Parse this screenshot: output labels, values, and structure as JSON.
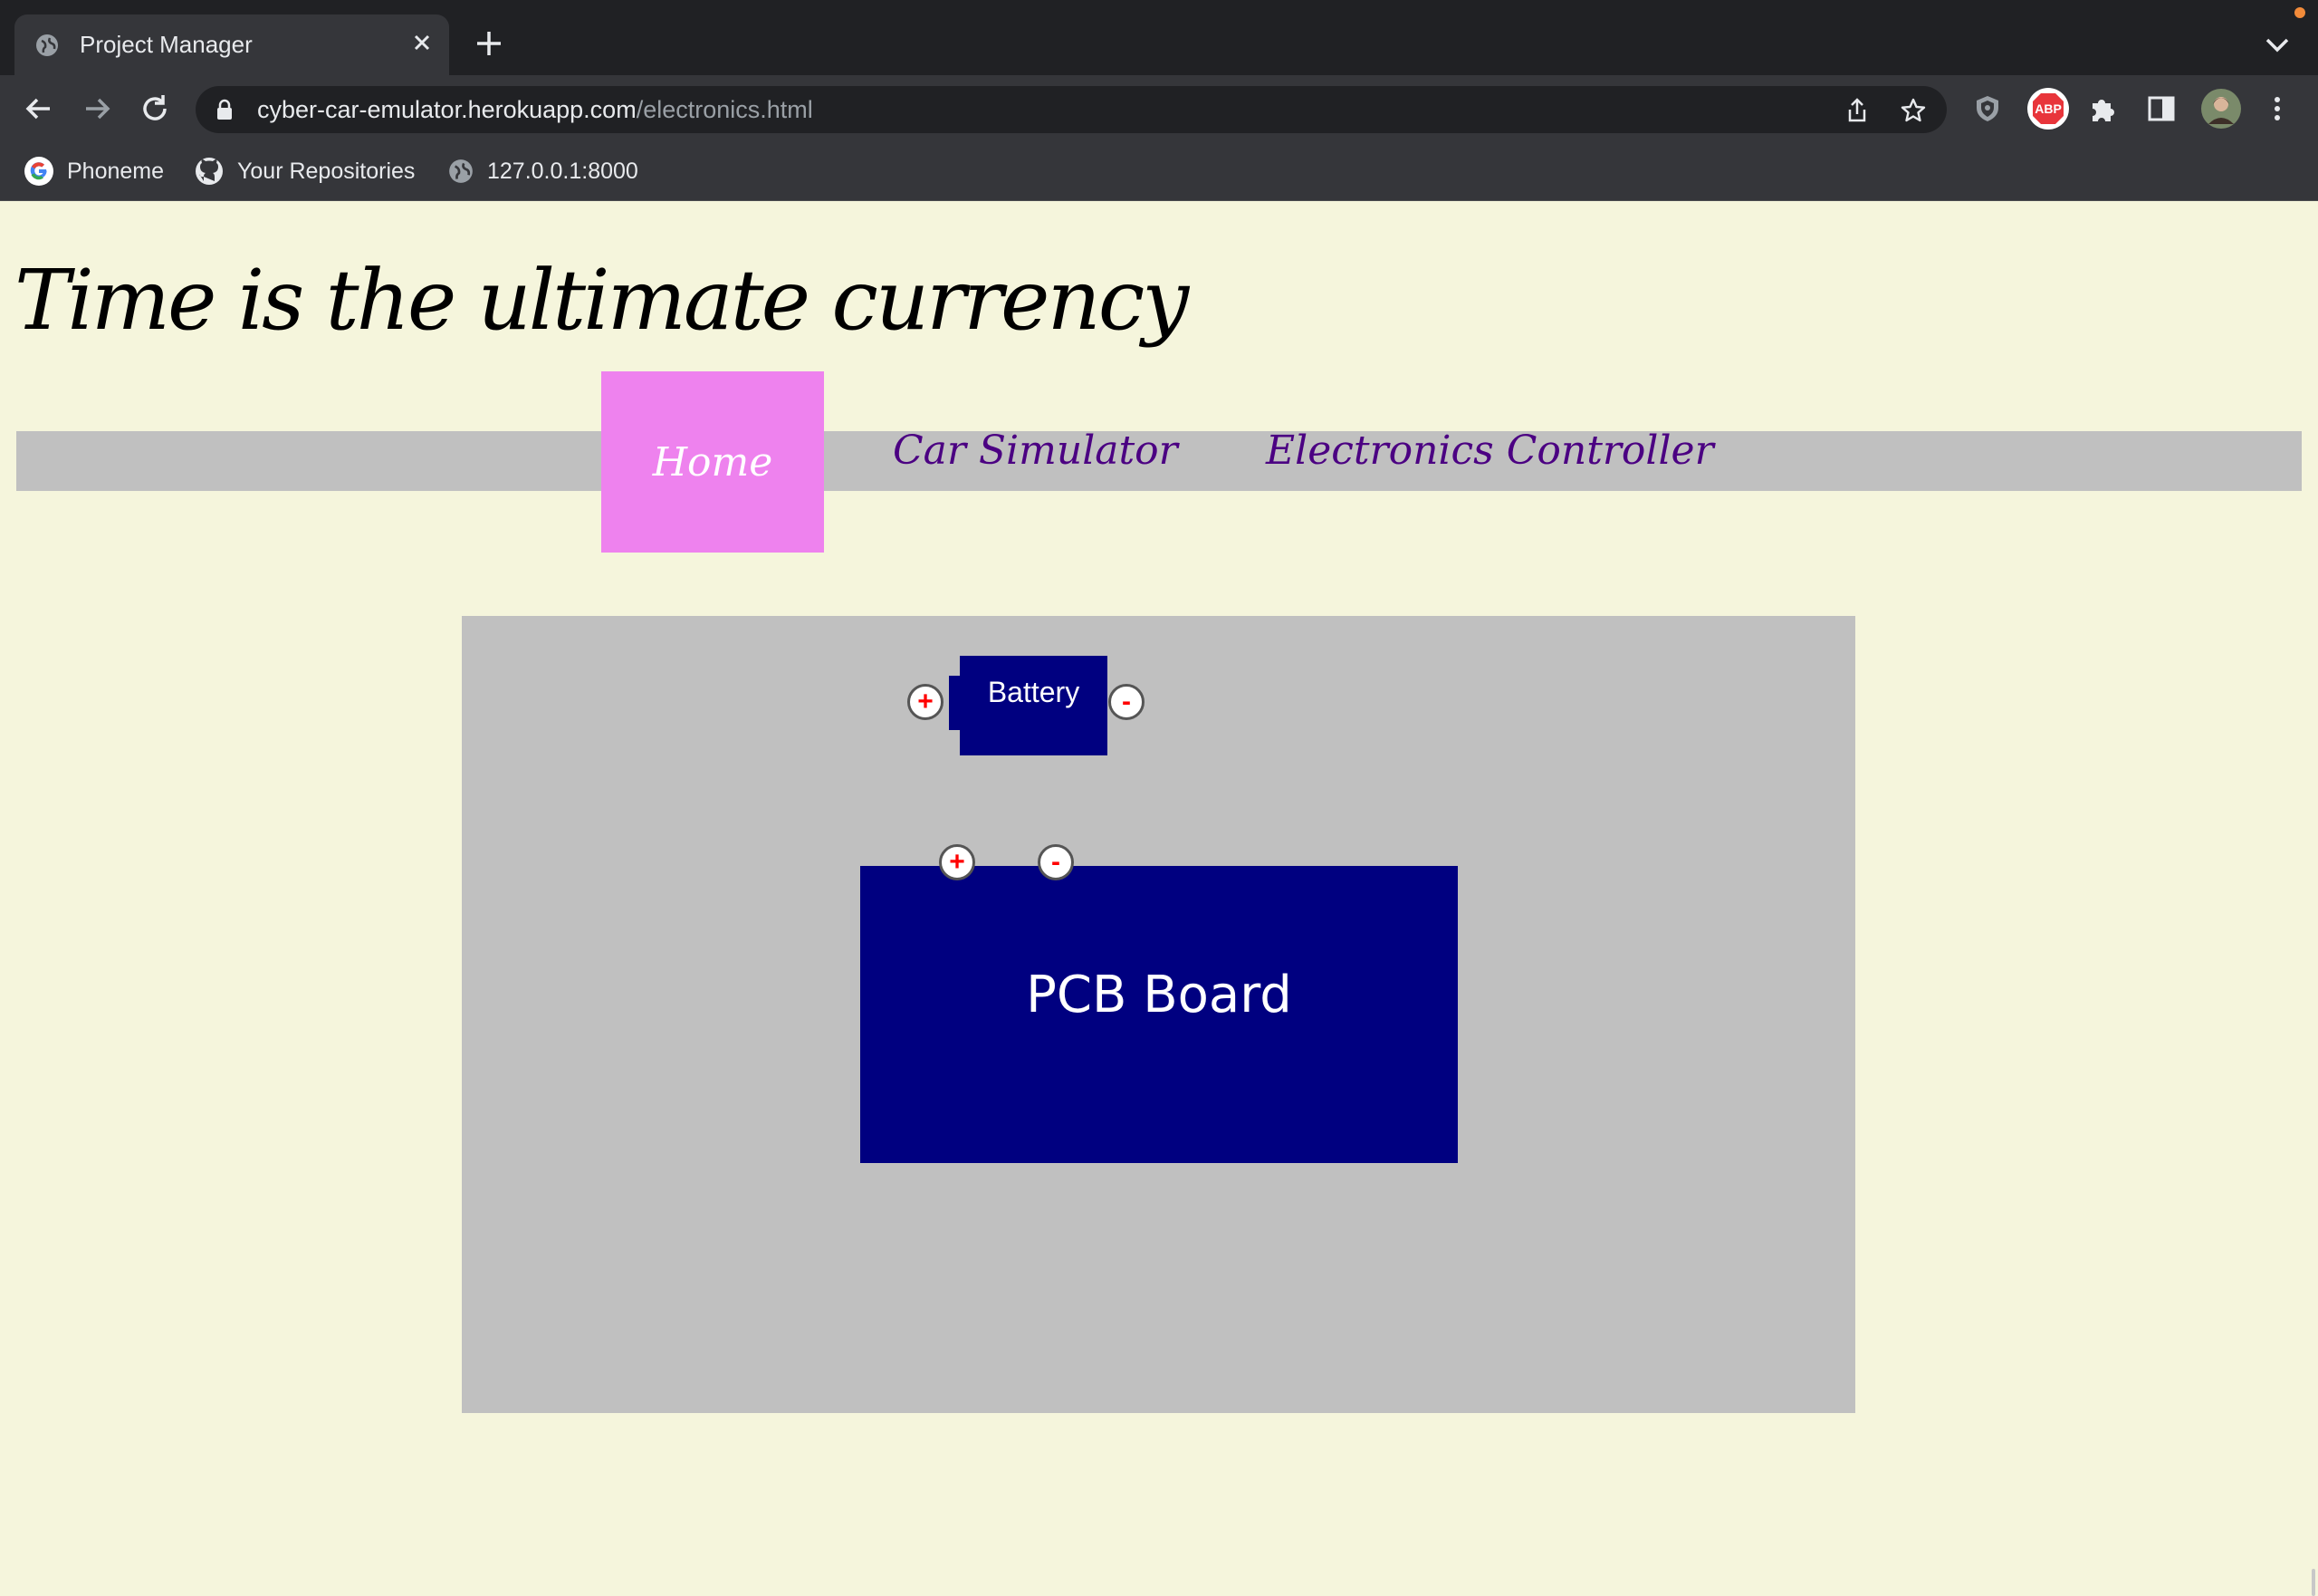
{
  "browser": {
    "tab": {
      "title": "Project Manager"
    },
    "address": {
      "domain": "cyber-car-emulator.herokuapp.com",
      "path": "/electronics.html"
    },
    "bookmarks": [
      {
        "label": "Phoneme",
        "icon": "google-icon"
      },
      {
        "label": "Your Repositories",
        "icon": "github-icon"
      },
      {
        "label": "127.0.0.1:8000",
        "icon": "globe-icon"
      }
    ],
    "extensions": [
      "shield-extension-icon",
      "adblock-plus-icon",
      "puzzle-extensions-icon",
      "side-panel-icon",
      "profile-avatar"
    ],
    "abp_label": "ABP"
  },
  "page": {
    "title": "Time is the ultimate currency",
    "nav": [
      {
        "label": "Home",
        "active": true
      },
      {
        "label": "Car Simulator",
        "active": false
      },
      {
        "label": "Electronics Controller",
        "active": false
      }
    ]
  },
  "workspace": {
    "battery": {
      "label": "Battery",
      "positive": "+",
      "negative": "-"
    },
    "pcb": {
      "label": "PCB Board",
      "positive": "+",
      "negative": "-"
    }
  },
  "colors": {
    "page_bg": "#f5f5dc",
    "nav_bar": "#c0c0c0",
    "nav_active": "#ee82ee",
    "nav_link": "#4b0082",
    "component": "#000080",
    "terminal_sign": "#ff0000"
  }
}
